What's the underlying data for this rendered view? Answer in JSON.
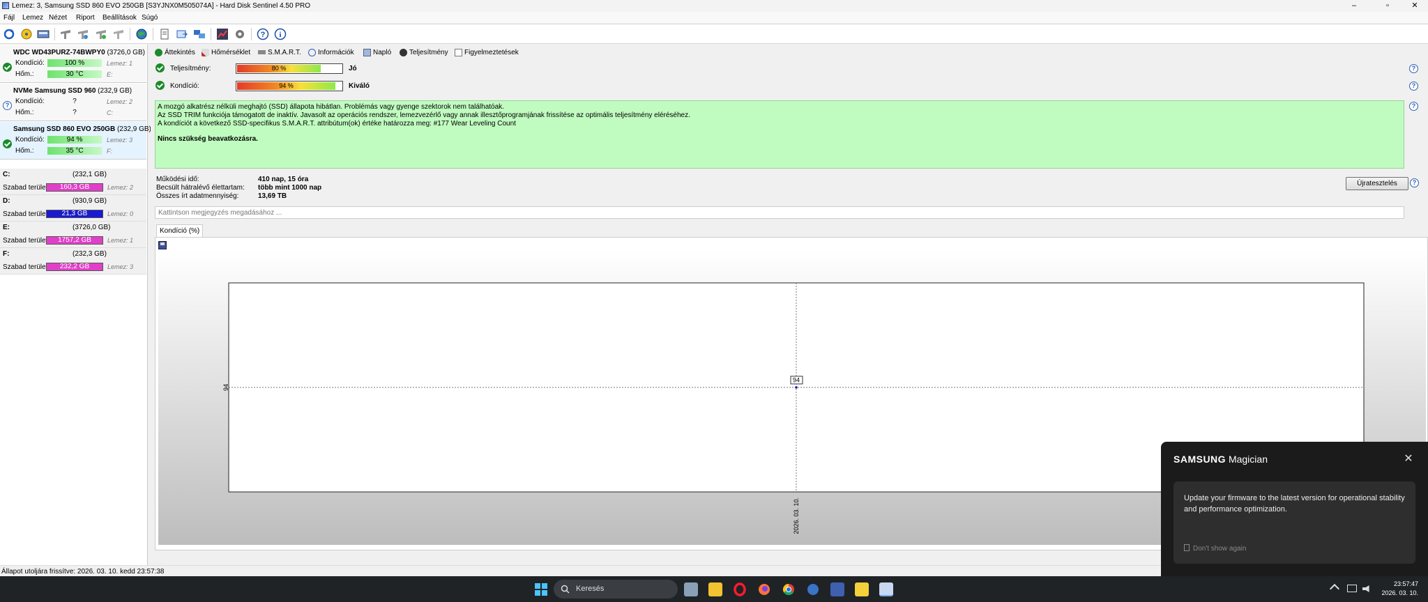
{
  "window": {
    "title": "Lemez: 3, Samsung SSD 860 EVO 250GB [S3YJNX0M505074A]  -  Hard Disk Sentinel 4.50 PRO",
    "minimize": "–",
    "maximize": "▫",
    "close": "✕"
  },
  "menu": [
    "Fájl",
    "Lemez",
    "Nézet",
    "Riport",
    "Beállítások",
    "Súgó"
  ],
  "disks": [
    {
      "name": "WDC WD43PURZ-74BWPY0",
      "size": "(3726,0 GB)",
      "status": "ok",
      "condition_label": "Kondíció:",
      "condition": "100 %",
      "temp_label": "Hőm.:",
      "temp": "30 °C",
      "disk_ref": "Lemez: 1",
      "drive": "E:"
    },
    {
      "name": "NVMe   Samsung SSD 960",
      "size": "(232,9 GB)",
      "status": "unknown",
      "condition_label": "Kondíció:",
      "condition": "?",
      "temp_label": "Hőm.:",
      "temp": "?",
      "disk_ref": "Lemez: 2",
      "drive": "C:"
    },
    {
      "name": "Samsung SSD 860 EVO 250GB",
      "size": "(232,9 GB)",
      "status": "ok",
      "condition_label": "Kondíció:",
      "condition": "94 %",
      "temp_label": "Hőm.:",
      "temp": "35 °C",
      "disk_ref": "Lemez: 3",
      "drive": "F:"
    }
  ],
  "volumes": [
    {
      "letter": "C:",
      "size": "(232,1 GB)",
      "free_label": "Szabad terület",
      "free": "160,3 GB",
      "disk": "Lemez: 2",
      "color": "#e040c8"
    },
    {
      "letter": "D:",
      "size": "(930,9 GB)",
      "free_label": "Szabad terület",
      "free": "21,3 GB",
      "disk": "Lemez: 0",
      "color": "#1a1ad0"
    },
    {
      "letter": "E:",
      "size": "(3726,0 GB)",
      "free_label": "Szabad terület",
      "free": "1757,2 GB",
      "disk": "Lemez: 1",
      "color": "#e040c8"
    },
    {
      "letter": "F:",
      "size": "(232,3 GB)",
      "free_label": "Szabad terület",
      "free": "232,2 GB",
      "disk": "Lemez: 3",
      "color": "#e040c8"
    }
  ],
  "tabs": [
    "Áttekintés",
    "Hőmérséklet",
    "S.M.A.R.T.",
    "Információk",
    "Napló",
    "Teljesítmény",
    "Figyelmeztetések"
  ],
  "performance": {
    "label": "Teljesítmény:",
    "value": "80 %",
    "percent": 80,
    "rating": "Jó"
  },
  "condition": {
    "label": "Kondíció:",
    "value": "94 %",
    "percent": 94,
    "rating": "Kiváló"
  },
  "info": {
    "line1": "A mozgó alkatrész nélküli meghajtó (SSD) állapota hibátlan. Problémás vagy gyenge szektorok nem találhatóak.",
    "line2": "Az SSD TRIM funkciója támogatott de inaktív. Javasolt az operációs rendszer, lemezvezérlő vagy annak illesztőprogramjának frissítése az optimális teljesítmény eléréséhez.",
    "line3": "A kondíciót a következő SSD-specifikus S.M.A.R.T. attribútum(ok) értéke határozza meg:  #177 Wear Leveling Count",
    "action": "Nincs szükség beavatkozásra."
  },
  "stats": {
    "uptime_label": "Működési idő:",
    "uptime": "410 nap, 15 óra",
    "lifetime_label": "Becsült hátralévő élettartam:",
    "lifetime": "több mint 1000 nap",
    "written_label": "Összes írt adatmennyiség:",
    "written": "13,69 TB"
  },
  "retest_button": "Újratesztelés",
  "help_glyph": "?",
  "note_placeholder": "Kattintson megjegyzés megadásához ...",
  "chart_tab": "Kondíció  (%)",
  "chart_data": {
    "type": "line",
    "x": [
      "2026. 03. 10."
    ],
    "series": [
      {
        "values": [
          94
        ]
      }
    ],
    "y_tick_labels": [
      "94"
    ],
    "data_labels": [
      "94"
    ],
    "grid": true
  },
  "statusbar": "Állapot utoljára frissítve: 2026. 03. 10. kedd 23:57:38",
  "taskbar": {
    "search": "Keresés",
    "time": "23:57:47",
    "date": "2026. 03. 10."
  },
  "popup": {
    "brand_bold": "SAMSUNG",
    "brand_rest": " Magician",
    "message": "Update your firmware to the latest version for operational stability and performance optimization.",
    "dont_show": "Don't show again",
    "close": "✕"
  },
  "colors": {
    "info_bg": "#c0fbc0",
    "selected_disk": "#e5f3ff",
    "ok_green": "#1a8a2a",
    "taskbar": "#1f2326"
  }
}
